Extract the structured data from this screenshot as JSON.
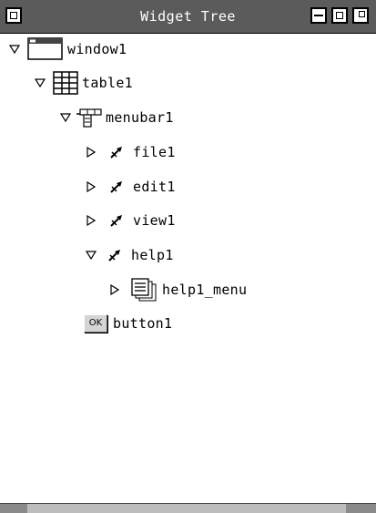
{
  "window": {
    "title": "Widget Tree"
  },
  "tree": {
    "window1": {
      "label": "window1"
    },
    "table1": {
      "label": "table1"
    },
    "menubar1": {
      "label": "menubar1"
    },
    "file1": {
      "label": "file1"
    },
    "edit1": {
      "label": "edit1"
    },
    "view1": {
      "label": "view1"
    },
    "help1": {
      "label": "help1"
    },
    "help1_menu": {
      "label": "help1_menu"
    },
    "button1": {
      "label": "button1",
      "icon_text": "OK"
    }
  }
}
